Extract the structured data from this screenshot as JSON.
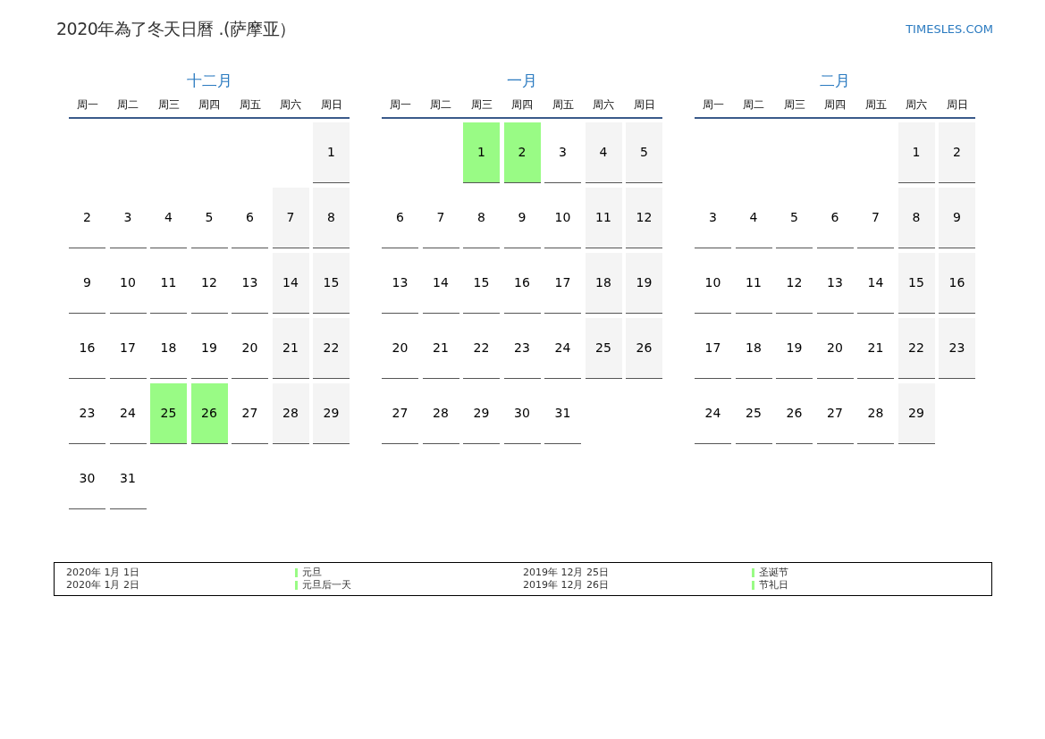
{
  "title": "2020年為了冬天日曆 .(萨摩亚）",
  "site": "TIMESLES.COM",
  "months": [
    {
      "name": "十二月",
      "weekdays": [
        "周一",
        "周二",
        "周三",
        "周四",
        "周五",
        "周六",
        "周日"
      ],
      "weeks": [
        [
          {
            "kind": "empty"
          },
          {
            "kind": "empty"
          },
          {
            "kind": "empty"
          },
          {
            "kind": "empty"
          },
          {
            "kind": "empty"
          },
          {
            "kind": "empty"
          },
          {
            "kind": "weekend",
            "day": "1"
          }
        ],
        [
          {
            "kind": "weekday",
            "day": "2"
          },
          {
            "kind": "weekday",
            "day": "3"
          },
          {
            "kind": "weekday",
            "day": "4"
          },
          {
            "kind": "weekday",
            "day": "5"
          },
          {
            "kind": "weekday",
            "day": "6"
          },
          {
            "kind": "weekend",
            "day": "7"
          },
          {
            "kind": "weekend",
            "day": "8"
          }
        ],
        [
          {
            "kind": "weekday",
            "day": "9"
          },
          {
            "kind": "weekday",
            "day": "10"
          },
          {
            "kind": "weekday",
            "day": "11"
          },
          {
            "kind": "weekday",
            "day": "12"
          },
          {
            "kind": "weekday",
            "day": "13"
          },
          {
            "kind": "weekend",
            "day": "14"
          },
          {
            "kind": "weekend",
            "day": "15"
          }
        ],
        [
          {
            "kind": "weekday",
            "day": "16"
          },
          {
            "kind": "weekday",
            "day": "17"
          },
          {
            "kind": "weekday",
            "day": "18"
          },
          {
            "kind": "weekday",
            "day": "19"
          },
          {
            "kind": "weekday",
            "day": "20"
          },
          {
            "kind": "weekend",
            "day": "21"
          },
          {
            "kind": "weekend",
            "day": "22"
          }
        ],
        [
          {
            "kind": "weekday",
            "day": "23"
          },
          {
            "kind": "weekday",
            "day": "24"
          },
          {
            "kind": "holiday",
            "day": "25"
          },
          {
            "kind": "holiday",
            "day": "26"
          },
          {
            "kind": "weekday",
            "day": "27"
          },
          {
            "kind": "weekend",
            "day": "28"
          },
          {
            "kind": "weekend",
            "day": "29"
          }
        ],
        [
          {
            "kind": "weekday",
            "day": "30"
          },
          {
            "kind": "weekday",
            "day": "31"
          },
          {
            "kind": "empty"
          },
          {
            "kind": "empty"
          },
          {
            "kind": "empty"
          },
          {
            "kind": "empty"
          },
          {
            "kind": "empty"
          }
        ]
      ]
    },
    {
      "name": "一月",
      "weekdays": [
        "周一",
        "周二",
        "周三",
        "周四",
        "周五",
        "周六",
        "周日"
      ],
      "weeks": [
        [
          {
            "kind": "empty"
          },
          {
            "kind": "empty"
          },
          {
            "kind": "holiday",
            "day": "1"
          },
          {
            "kind": "holiday",
            "day": "2"
          },
          {
            "kind": "weekday",
            "day": "3"
          },
          {
            "kind": "weekend",
            "day": "4"
          },
          {
            "kind": "weekend",
            "day": "5"
          }
        ],
        [
          {
            "kind": "weekday",
            "day": "6"
          },
          {
            "kind": "weekday",
            "day": "7"
          },
          {
            "kind": "weekday",
            "day": "8"
          },
          {
            "kind": "weekday",
            "day": "9"
          },
          {
            "kind": "weekday",
            "day": "10"
          },
          {
            "kind": "weekend",
            "day": "11"
          },
          {
            "kind": "weekend",
            "day": "12"
          }
        ],
        [
          {
            "kind": "weekday",
            "day": "13"
          },
          {
            "kind": "weekday",
            "day": "14"
          },
          {
            "kind": "weekday",
            "day": "15"
          },
          {
            "kind": "weekday",
            "day": "16"
          },
          {
            "kind": "weekday",
            "day": "17"
          },
          {
            "kind": "weekend",
            "day": "18"
          },
          {
            "kind": "weekend",
            "day": "19"
          }
        ],
        [
          {
            "kind": "weekday",
            "day": "20"
          },
          {
            "kind": "weekday",
            "day": "21"
          },
          {
            "kind": "weekday",
            "day": "22"
          },
          {
            "kind": "weekday",
            "day": "23"
          },
          {
            "kind": "weekday",
            "day": "24"
          },
          {
            "kind": "weekend",
            "day": "25"
          },
          {
            "kind": "weekend",
            "day": "26"
          }
        ],
        [
          {
            "kind": "weekday",
            "day": "27"
          },
          {
            "kind": "weekday",
            "day": "28"
          },
          {
            "kind": "weekday",
            "day": "29"
          },
          {
            "kind": "weekday",
            "day": "30"
          },
          {
            "kind": "weekday",
            "day": "31"
          },
          {
            "kind": "empty"
          },
          {
            "kind": "empty"
          }
        ]
      ]
    },
    {
      "name": "二月",
      "weekdays": [
        "周一",
        "周二",
        "周三",
        "周四",
        "周五",
        "周六",
        "周日"
      ],
      "weeks": [
        [
          {
            "kind": "empty"
          },
          {
            "kind": "empty"
          },
          {
            "kind": "empty"
          },
          {
            "kind": "empty"
          },
          {
            "kind": "empty"
          },
          {
            "kind": "weekend",
            "day": "1"
          },
          {
            "kind": "weekend",
            "day": "2"
          }
        ],
        [
          {
            "kind": "weekday",
            "day": "3"
          },
          {
            "kind": "weekday",
            "day": "4"
          },
          {
            "kind": "weekday",
            "day": "5"
          },
          {
            "kind": "weekday",
            "day": "6"
          },
          {
            "kind": "weekday",
            "day": "7"
          },
          {
            "kind": "weekend",
            "day": "8"
          },
          {
            "kind": "weekend",
            "day": "9"
          }
        ],
        [
          {
            "kind": "weekday",
            "day": "10"
          },
          {
            "kind": "weekday",
            "day": "11"
          },
          {
            "kind": "weekday",
            "day": "12"
          },
          {
            "kind": "weekday",
            "day": "13"
          },
          {
            "kind": "weekday",
            "day": "14"
          },
          {
            "kind": "weekend",
            "day": "15"
          },
          {
            "kind": "weekend",
            "day": "16"
          }
        ],
        [
          {
            "kind": "weekday",
            "day": "17"
          },
          {
            "kind": "weekday",
            "day": "18"
          },
          {
            "kind": "weekday",
            "day": "19"
          },
          {
            "kind": "weekday",
            "day": "20"
          },
          {
            "kind": "weekday",
            "day": "21"
          },
          {
            "kind": "weekend",
            "day": "22"
          },
          {
            "kind": "weekend",
            "day": "23"
          }
        ],
        [
          {
            "kind": "weekday",
            "day": "24"
          },
          {
            "kind": "weekday",
            "day": "25"
          },
          {
            "kind": "weekday",
            "day": "26"
          },
          {
            "kind": "weekday",
            "day": "27"
          },
          {
            "kind": "weekday",
            "day": "28"
          },
          {
            "kind": "weekend",
            "day": "29"
          },
          {
            "kind": "empty"
          }
        ]
      ]
    }
  ],
  "legend": [
    {
      "date": "2020年 1月 1日",
      "name": "元旦",
      "color": "#99fb85"
    },
    {
      "date": "2020年 1月 2日",
      "name": "元旦后一天",
      "color": "#99fb85"
    },
    {
      "date": "2019年 12月 25日",
      "name": "圣诞节",
      "color": "#99fb85"
    },
    {
      "date": "2019年 12月 26日",
      "name": "节礼日",
      "color": "#99fb85"
    }
  ]
}
